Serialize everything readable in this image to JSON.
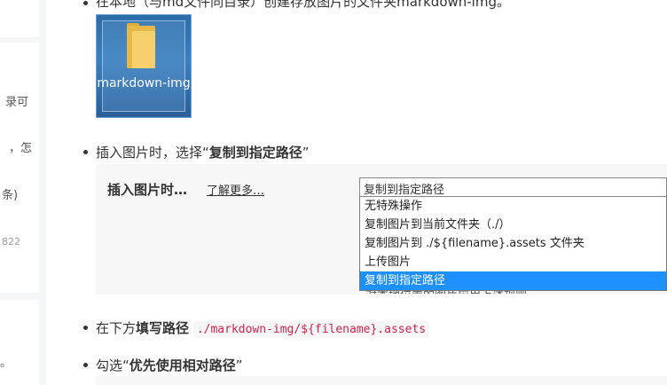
{
  "sidebar": {
    "fragments": [
      "录可",
      "，怎",
      "条)",
      "822",
      "。"
    ]
  },
  "article": {
    "step1_text": "在本地（与md文件同目录）创建存放图片的文件夹markdown-img。",
    "folder_label": "markdown-img",
    "step2_prefix": "插入图片时，选择“",
    "step2_bold": "复制到指定路径",
    "step2_suffix": "”",
    "step3_prefix": "在下方",
    "step3_bold": "填写路径",
    "step3_code": "./markdown-img/${filename}.assets",
    "step4_prefix": "勾选“",
    "step4_bold": "优先使用相对路径",
    "step4_suffix": "”"
  },
  "panel": {
    "label": "插入图片时…",
    "learn_more": "了解更多…",
    "selected_value": "复制到指定路径",
    "behind_text": "对本地位置的图片应用上述规则",
    "options": [
      "无特殊操作",
      "复制图片到当前文件夹（./）",
      "复制图片到 ./${filename}.assets 文件夹",
      "上传图片",
      "复制到指定路径"
    ],
    "selected_index": 4
  },
  "colors": {
    "selected_option": "#1e90ff",
    "code_text": "#c7254e"
  }
}
